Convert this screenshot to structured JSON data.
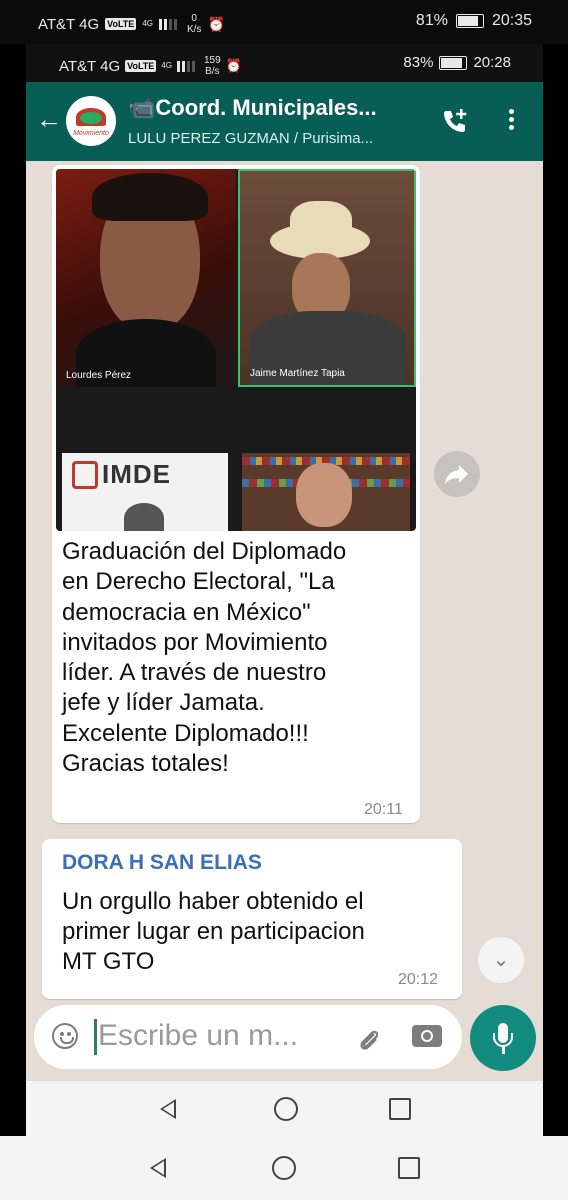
{
  "outer_status": {
    "carrier": "AT&T 4G",
    "volte": "VoLTE",
    "net_type": "4G",
    "speed_value": "0",
    "speed_unit": "K/s",
    "battery": "81%",
    "time": "20:35",
    "battery_level": 0.81
  },
  "inner_status": {
    "carrier": "AT&T 4G",
    "volte": "VoLTE",
    "net_type": "4G",
    "speed_value": "159",
    "speed_unit": "B/s",
    "battery": "83%",
    "time": "20:28",
    "battery_level": 0.83
  },
  "header": {
    "title": "📹Coord. Municipales...",
    "subtitle": "LULU PEREZ GUZMAN / Purisima...",
    "avatar_text": "Movimiento",
    "back_icon": "arrow-left-icon",
    "call_icon": "add-call-icon",
    "menu_icon": "more-vert-icon"
  },
  "messages": [
    {
      "participants": [
        "Lourdes Pérez",
        "Jaime Martínez Tapia"
      ],
      "logo_text": "IMDE",
      "text": "Graduación del Diplomado\nen Derecho Electoral, \"La\ndemocracia en México\"\ninvitados por Movimiento\nlíder.  A través de nuestro\njefe y líder Jamata.\nExcelente Diplomado!!!\nGracias totales!",
      "time": "20:11"
    },
    {
      "sender": "DORA H SAN ELIAS",
      "text": "Un orgullo haber obtenido el\nprimer lugar en participacion\nMT GTO",
      "time": "20:12"
    }
  ],
  "composer": {
    "placeholder": "Escribe un m...",
    "emoji_icon": "emoji-icon",
    "attach_icon": "paperclip-icon",
    "camera_icon": "camera-icon",
    "mic_icon": "mic-icon"
  },
  "colors": {
    "header": "#075e54",
    "chat_bg": "#e5ddd5",
    "mic_button": "#128c7e",
    "sender_name": "#3a6fb5"
  }
}
